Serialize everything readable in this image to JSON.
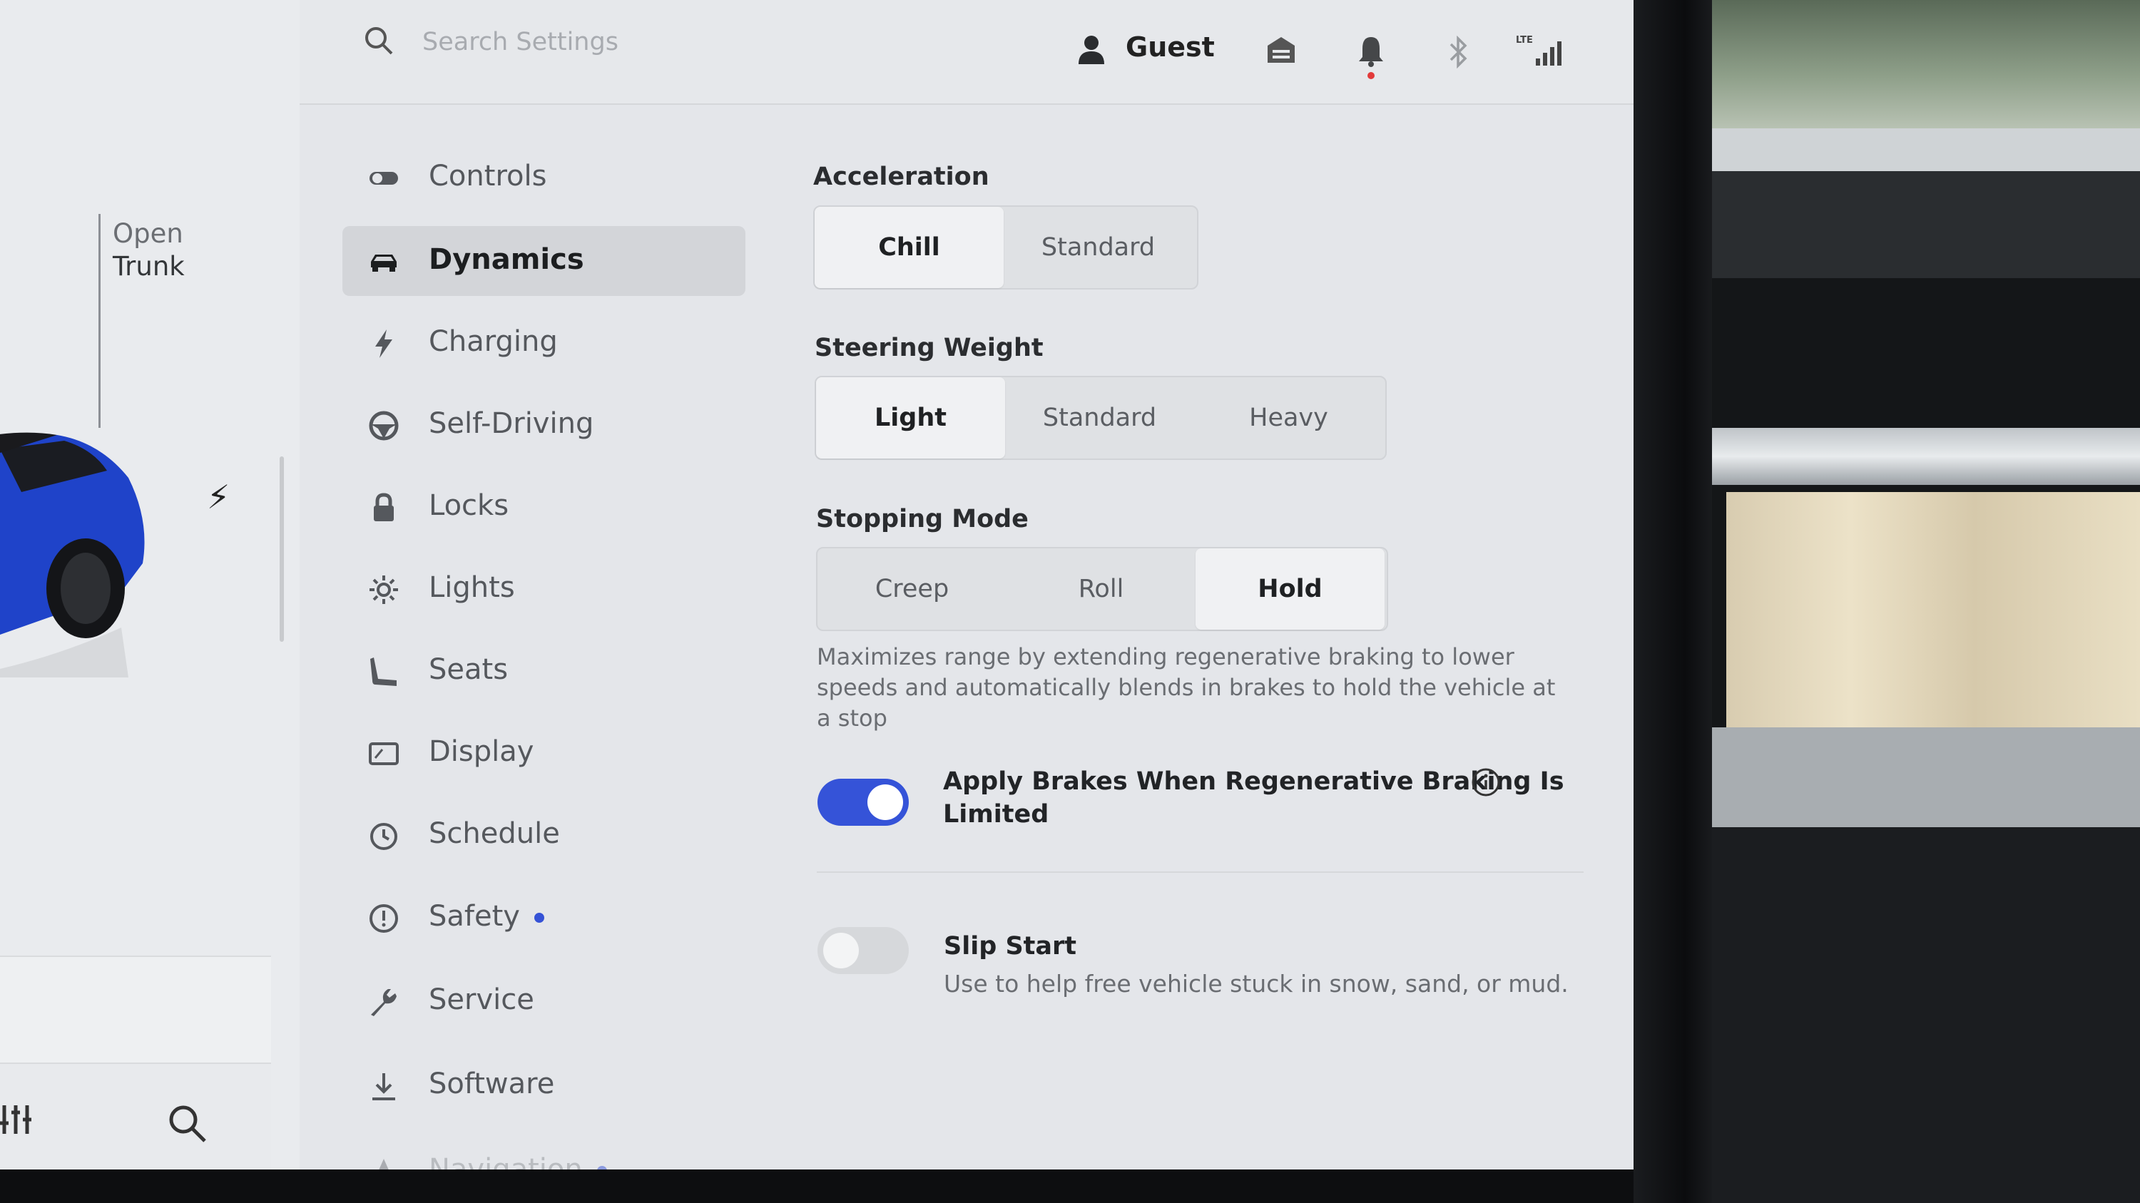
{
  "search": {
    "placeholder": "Search Settings"
  },
  "topbar": {
    "user_label": "Guest",
    "signal_label": "LTE"
  },
  "car_panel": {
    "trunk_line1": "Open",
    "trunk_line2": "Trunk"
  },
  "sidebar": {
    "items": [
      {
        "label": "Controls",
        "icon": "toggle-icon"
      },
      {
        "label": "Dynamics",
        "icon": "car-icon",
        "active": true
      },
      {
        "label": "Charging",
        "icon": "bolt-icon"
      },
      {
        "label": "Self-Driving",
        "icon": "steering-wheel-icon"
      },
      {
        "label": "Locks",
        "icon": "lock-icon"
      },
      {
        "label": "Lights",
        "icon": "sun-icon"
      },
      {
        "label": "Seats",
        "icon": "seat-icon"
      },
      {
        "label": "Display",
        "icon": "display-icon"
      },
      {
        "label": "Schedule",
        "icon": "clock-icon"
      },
      {
        "label": "Safety",
        "icon": "alert-icon",
        "badge": true
      },
      {
        "label": "Service",
        "icon": "wrench-icon"
      },
      {
        "label": "Software",
        "icon": "download-icon"
      },
      {
        "label": "Navigation",
        "icon": "navigation-icon",
        "badge": true
      }
    ]
  },
  "acceleration": {
    "title": "Acceleration",
    "options": [
      "Chill",
      "Standard"
    ],
    "selected": "Chill"
  },
  "steering_weight": {
    "title": "Steering Weight",
    "options": [
      "Light",
      "Standard",
      "Heavy"
    ],
    "selected": "Light"
  },
  "stopping_mode": {
    "title": "Stopping Mode",
    "options": [
      "Creep",
      "Roll",
      "Hold"
    ],
    "selected": "Hold",
    "description": "Maximizes range by extending regenerative braking to lower speeds and automatically blends in brakes to hold the vehicle at a stop"
  },
  "apply_brakes": {
    "line1": "Apply Brakes When Regenerative Braking Is",
    "line2": "Limited",
    "enabled": true
  },
  "slip_start": {
    "title": "Slip Start",
    "subtitle": "Use to help free vehicle stuck in snow, sand, or mud.",
    "enabled": false
  },
  "colors": {
    "accent": "#3553d8",
    "active_bg": "#d3d5d9",
    "badge": "#3552d6"
  }
}
